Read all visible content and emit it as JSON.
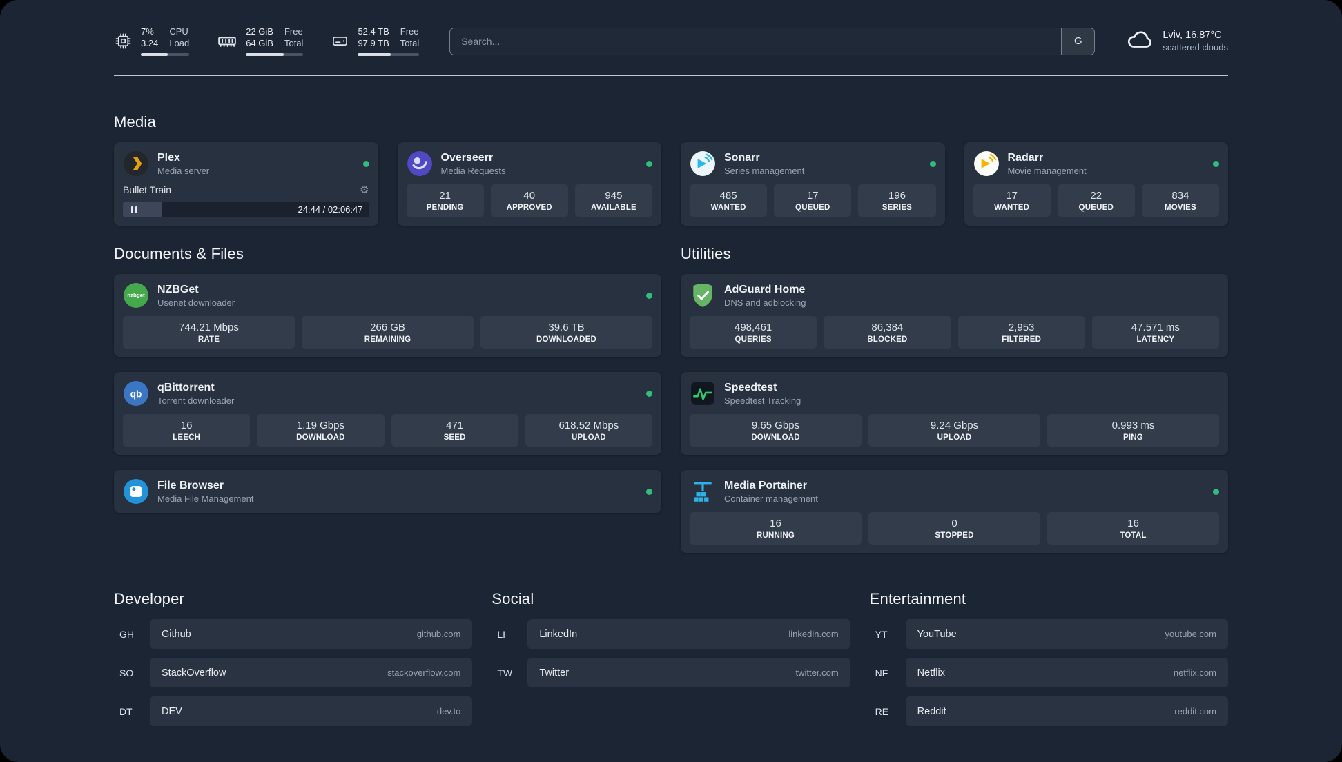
{
  "topbar": {
    "resources": [
      {
        "icon": "cpu-icon",
        "value_top": "7%",
        "value_bottom": "3.24",
        "label_top": "CPU",
        "label_bottom": "Load",
        "progress": 55
      },
      {
        "icon": "memory-icon",
        "value_top": "22 GiB",
        "value_bottom": "64 GiB",
        "label_top": "Free",
        "label_bottom": "Total",
        "progress": 66
      },
      {
        "icon": "disk-icon",
        "value_top": "52.4 TB",
        "value_bottom": "97.9 TB",
        "label_top": "Free",
        "label_bottom": "Total",
        "progress": 54
      }
    ],
    "search": {
      "placeholder": "Search...",
      "provider": "G"
    },
    "weather": {
      "location": "Lviv, 16.87°C",
      "condition": "scattered clouds"
    }
  },
  "sections": {
    "media": {
      "title": "Media",
      "plex": {
        "name": "Plex",
        "description": "Media server",
        "status": "online",
        "now_playing": "Bullet Train",
        "time": "24:44 / 02:06:47",
        "progress": 16
      },
      "overseerr": {
        "name": "Overseerr",
        "description": "Media Requests",
        "status": "online",
        "stats": [
          {
            "value": "21",
            "label": "PENDING"
          },
          {
            "value": "40",
            "label": "APPROVED"
          },
          {
            "value": "945",
            "label": "AVAILABLE"
          }
        ]
      },
      "sonarr": {
        "name": "Sonarr",
        "description": "Series management",
        "status": "online",
        "stats": [
          {
            "value": "485",
            "label": "WANTED"
          },
          {
            "value": "17",
            "label": "QUEUED"
          },
          {
            "value": "196",
            "label": "SERIES"
          }
        ]
      },
      "radarr": {
        "name": "Radarr",
        "description": "Movie management",
        "status": "online",
        "stats": [
          {
            "value": "17",
            "label": "WANTED"
          },
          {
            "value": "22",
            "label": "QUEUED"
          },
          {
            "value": "834",
            "label": "MOVIES"
          }
        ]
      }
    },
    "documents": {
      "title": "Documents & Files",
      "nzbget": {
        "name": "NZBGet",
        "description": "Usenet downloader",
        "status": "online",
        "stats": [
          {
            "value": "744.21 Mbps",
            "label": "RATE"
          },
          {
            "value": "266 GB",
            "label": "REMAINING"
          },
          {
            "value": "39.6 TB",
            "label": "DOWNLOADED"
          }
        ]
      },
      "qbittorrent": {
        "name": "qBittorrent",
        "description": "Torrent downloader",
        "status": "online",
        "stats": [
          {
            "value": "16",
            "label": "LEECH"
          },
          {
            "value": "1.19 Gbps",
            "label": "DOWNLOAD"
          },
          {
            "value": "471",
            "label": "SEED"
          },
          {
            "value": "618.52 Mbps",
            "label": "UPLOAD"
          }
        ]
      },
      "filebrowser": {
        "name": "File Browser",
        "description": "Media File Management",
        "status": "online"
      }
    },
    "utilities": {
      "title": "Utilities",
      "adguard": {
        "name": "AdGuard Home",
        "description": "DNS and adblocking",
        "stats": [
          {
            "value": "498,461",
            "label": "QUERIES"
          },
          {
            "value": "86,384",
            "label": "BLOCKED"
          },
          {
            "value": "2,953",
            "label": "FILTERED"
          },
          {
            "value": "47.571 ms",
            "label": "LATENCY"
          }
        ]
      },
      "speedtest": {
        "name": "Speedtest",
        "description": "Speedtest Tracking",
        "stats": [
          {
            "value": "9.65 Gbps",
            "label": "DOWNLOAD"
          },
          {
            "value": "9.24 Gbps",
            "label": "UPLOAD"
          },
          {
            "value": "0.993 ms",
            "label": "PING"
          }
        ]
      },
      "portainer": {
        "name": "Media Portainer",
        "description": "Container management",
        "status": "online",
        "stats": [
          {
            "value": "16",
            "label": "RUNNING"
          },
          {
            "value": "0",
            "label": "STOPPED"
          },
          {
            "value": "16",
            "label": "TOTAL"
          }
        ]
      }
    },
    "bookmarks": {
      "developer": {
        "title": "Developer",
        "items": [
          {
            "abbr": "GH",
            "name": "Github",
            "domain": "github.com"
          },
          {
            "abbr": "SO",
            "name": "StackOverflow",
            "domain": "stackoverflow.com"
          },
          {
            "abbr": "DT",
            "name": "DEV",
            "domain": "dev.to"
          }
        ]
      },
      "social": {
        "title": "Social",
        "items": [
          {
            "abbr": "LI",
            "name": "LinkedIn",
            "domain": "linkedin.com"
          },
          {
            "abbr": "TW",
            "name": "Twitter",
            "domain": "twitter.com"
          }
        ]
      },
      "entertainment": {
        "title": "Entertainment",
        "items": [
          {
            "abbr": "YT",
            "name": "YouTube",
            "domain": "youtube.com"
          },
          {
            "abbr": "NF",
            "name": "Netflix",
            "domain": "netflix.com"
          },
          {
            "abbr": "RE",
            "name": "Reddit",
            "domain": "reddit.com"
          }
        ]
      }
    }
  }
}
